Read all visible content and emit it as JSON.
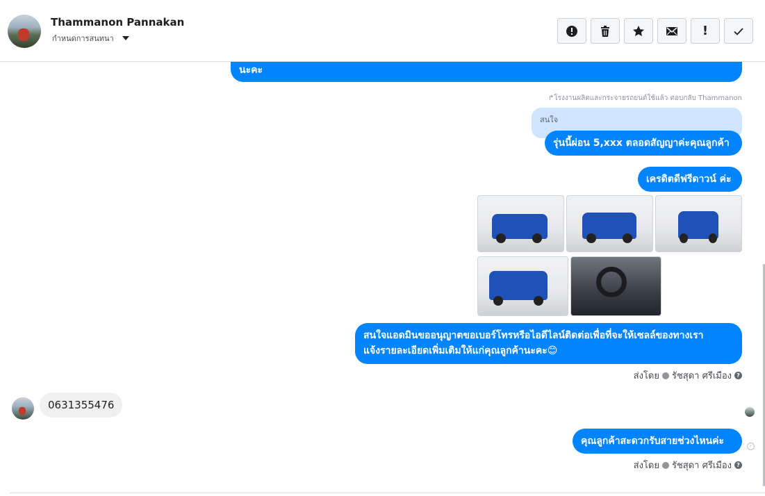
{
  "header": {
    "contact_name": "Thammanon Pannakan",
    "assign_label": "กำหนดการสนทนา",
    "toolbar": [
      {
        "icon": "alert-circle-icon",
        "name": "mark-spam-button"
      },
      {
        "icon": "trash-icon",
        "name": "delete-button"
      },
      {
        "icon": "star-icon",
        "name": "star-button"
      },
      {
        "icon": "envelope-icon",
        "name": "mark-unread-button"
      },
      {
        "icon": "exclamation-icon",
        "name": "follow-up-button",
        "glyph": "!"
      },
      {
        "icon": "check-icon",
        "name": "mark-done-button"
      }
    ]
  },
  "thread": {
    "msg_top_partial": "นะคะ",
    "reply_meta": "↱โรงงานผลิตและกระจายรถยนต์ใช้แล้ว ตอบกลับ Thammanon",
    "quoted_text": "สนใจ",
    "msg_reply": "รุ่นนี้ผ่อน 5,xxx ตลอดสัญญาค่ะคุณลูกค้า",
    "msg_credit": "เครดิตดีฟรีดาวน์ ค่ะ",
    "msg_ask_line1": "สนใจแอดมินขออนุญาตขอเบอร์โทรหรือไอดีไลน์ติดต่อเพื่อที่จะให้เซลล์ของทางเรา",
    "msg_ask_line2": "แจ้งรายละเอียดเพิ่มเติมให้แก่คุณลูกค้านะคะ😊",
    "sent_by_1": {
      "prefix": "ส่งโดย",
      "name": "รัชสุดา ศรีเมือง"
    },
    "incoming_phone": "0631355476",
    "msg_time_ask": "คุณลูกค้าสะดวกรับสายช่วงไหนค่ะ",
    "sent_by_2": {
      "prefix": "ส่งโดย",
      "name": "รัชสุดา ศรีเมือง"
    },
    "help_glyph": "?",
    "photos": [
      {
        "name": "truck-front-left-photo"
      },
      {
        "name": "truck-front-photo"
      },
      {
        "name": "truck-front-center-photo"
      },
      {
        "name": "truck-rear-photo"
      },
      {
        "name": "truck-interior-photo"
      }
    ]
  },
  "colors": {
    "accent": "#0084ff",
    "quote_bg": "#cfe4ff",
    "incoming_bg": "#f1f0f0"
  }
}
